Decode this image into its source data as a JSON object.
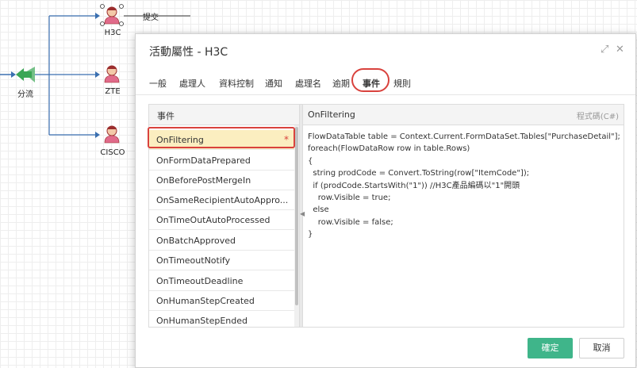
{
  "flow": {
    "nodes": [
      {
        "label": "H3C"
      },
      {
        "label": "ZTE"
      },
      {
        "label": "CISCO"
      },
      {
        "label": "分流"
      }
    ],
    "edge_label": "提交",
    "colors": {
      "line": "#3a6fb0",
      "split": "#3aa655",
      "user_body": "#e06a8a",
      "user_head": "#f3c9a8",
      "user_hair": "#9b2d2d"
    }
  },
  "dialog": {
    "title": "活動屬性 - H3C",
    "expand_icon": "expand-icon",
    "close_icon": "close-icon",
    "tabs": [
      "一般",
      "處理人",
      "資料控制",
      "通知",
      "處理名",
      "逾期",
      "事件",
      "規則"
    ],
    "active_tab": "事件",
    "left_header": "事件",
    "events": [
      "OnFiltering",
      "OnFormDataPrepared",
      "OnBeforePostMergeIn",
      "OnSameRecipientAutoAppro...",
      "OnTimeOutAutoProcessed",
      "OnBatchApproved",
      "OnTimeoutNotify",
      "OnTimeoutDeadline",
      "OnHumanStepCreated",
      "OnHumanStepEnded"
    ],
    "selected_event": "OnFiltering",
    "selected_marker": "*",
    "code_title": "OnFiltering",
    "code_lang": "程式碼(C#)",
    "code": "FlowDataTable table = Context.Current.FormDataSet.Tables[\"PurchaseDetail\"];\nforeach(FlowDataRow row in table.Rows)\n{\n  string prodCode = Convert.ToString(row[\"ItemCode\"]);\n  if (prodCode.StartsWith(\"1\")) //H3C產品編碼以\"1\"開頭\n    row.Visible = true;\n  else\n    row.Visible = false;\n}",
    "ok_label": "確定",
    "cancel_label": "取消",
    "colors": {
      "accent": "#3fb58a",
      "highlight": "#d9423d",
      "selected_bg": "#fbeec0"
    }
  }
}
